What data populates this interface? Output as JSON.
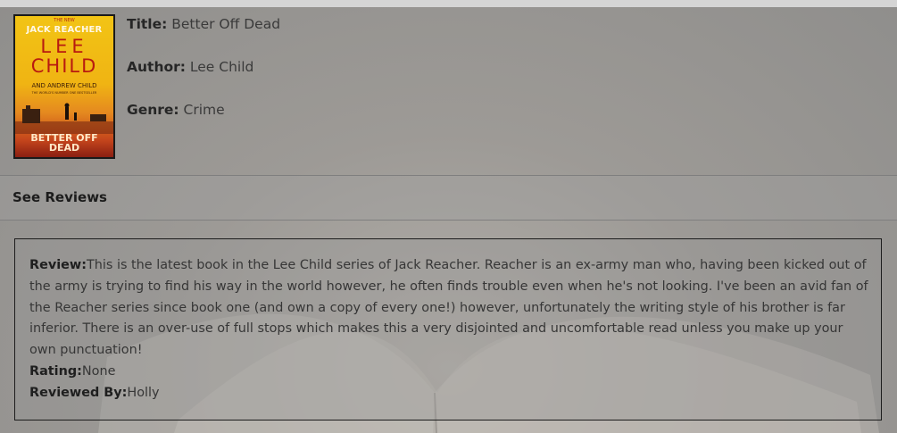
{
  "book": {
    "cover": {
      "series": "THE NEW",
      "brand": "JACK REACHER",
      "author_first": "LEE",
      "author_last": "CHILD",
      "coauthor": "AND ANDREW CHILD",
      "tagline": "THE WORLD'S NUMBER ONE BESTSELLER",
      "title_line1": "BETTER OFF",
      "title_line2": "DEAD"
    },
    "title_label": "Title:",
    "title_value": " Better Off Dead",
    "author_label": "Author:",
    "author_value": " Lee Child",
    "genre_label": "Genre:",
    "genre_value": " Crime"
  },
  "see_reviews_label": "See Reviews",
  "review": {
    "review_label": "Review:",
    "review_text": "This is the latest book in the Lee Child series of Jack Reacher. Reacher is an ex-army man who, having been kicked out of the army is trying to find his way in the world however, he often finds trouble even when he's not looking. I've been an avid fan of the Reacher series since book one (and own a copy of every one!) however, unfortunately the writing style of his brother is far inferior. There is an over-use of full stops which makes this a very disjointed and uncomfortable read unless you make up your own punctuation!",
    "rating_label": "Rating:",
    "rating_value": "None",
    "reviewer_label": "Reviewed By:",
    "reviewer_value": "Holly"
  },
  "colors": {
    "cover_yellow": "#f2c415",
    "cover_red": "#b81a10",
    "border": "#1d1d1d"
  }
}
